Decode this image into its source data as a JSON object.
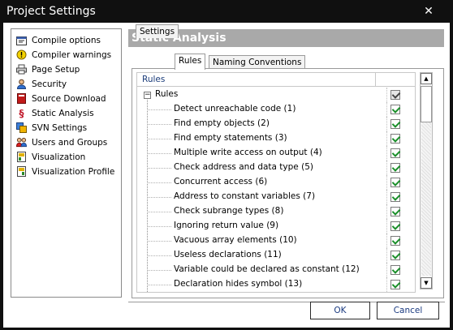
{
  "window": {
    "title": "Project Settings",
    "close_label": "✕"
  },
  "sidebar": {
    "items": [
      {
        "label": "Compile options",
        "icon": "compile-options-icon"
      },
      {
        "label": "Compiler warnings",
        "icon": "warning-icon"
      },
      {
        "label": "Page Setup",
        "icon": "printer-icon"
      },
      {
        "label": "Security",
        "icon": "user-icon"
      },
      {
        "label": "Source Download",
        "icon": "source-download-icon"
      },
      {
        "label": "Static Analysis",
        "icon": "static-analysis-icon"
      },
      {
        "label": "SVN Settings",
        "icon": "svn-icon"
      },
      {
        "label": "Users and Groups",
        "icon": "users-groups-icon"
      },
      {
        "label": "Visualization",
        "icon": "visualization-icon"
      },
      {
        "label": "Visualization Profile",
        "icon": "visualization-profile-icon"
      }
    ]
  },
  "panel": {
    "header": "Static Analysis",
    "tabs": [
      {
        "label": "Settings",
        "active": false
      },
      {
        "label": "Rules",
        "active": true
      },
      {
        "label": "Naming Conventions",
        "active": false
      }
    ],
    "grid": {
      "column_header": "Rules",
      "root": {
        "label": "Rules",
        "expander": "−",
        "checked": true
      },
      "rules": [
        {
          "label": "Detect unreachable code (1)",
          "checked": true
        },
        {
          "label": "Find empty objects (2)",
          "checked": true
        },
        {
          "label": "Find empty statements (3)",
          "checked": true
        },
        {
          "label": "Multiple write access on output (4)",
          "checked": true
        },
        {
          "label": "Check address and data type (5)",
          "checked": true
        },
        {
          "label": "Concurrent access (6)",
          "checked": true
        },
        {
          "label": "Address to constant variables (7)",
          "checked": true
        },
        {
          "label": "Check subrange types (8)",
          "checked": true
        },
        {
          "label": "Ignoring return value (9)",
          "checked": true
        },
        {
          "label": "Vacuous array elements (10)",
          "checked": true
        },
        {
          "label": "Useless declarations (11)",
          "checked": true
        },
        {
          "label": "Variable could be declared as constant (12)",
          "checked": true
        },
        {
          "label": "Declaration hides symbol (13)",
          "checked": true
        }
      ]
    },
    "scrollbar": {
      "up": "▲",
      "down": "▼"
    }
  },
  "buttons": {
    "ok": "OK",
    "cancel": "Cancel"
  },
  "colors": {
    "titlebar": "#101010",
    "header_bg": "#a9a9a9",
    "check_green": "#1a8f2a",
    "button_text": "#1a3a80"
  }
}
